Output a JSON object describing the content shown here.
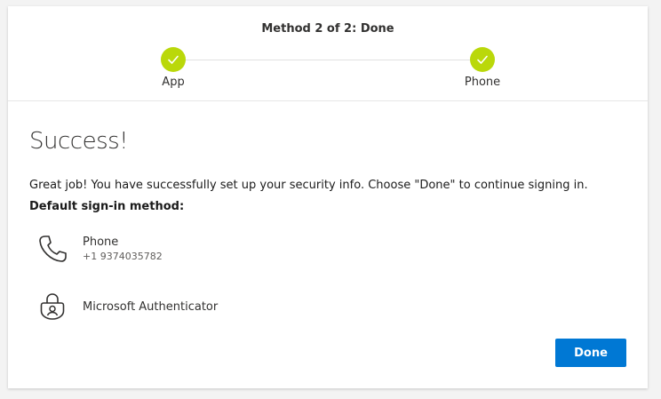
{
  "progress": {
    "title": "Method 2 of 2: Done",
    "steps": [
      {
        "label": "App",
        "status": "completed"
      },
      {
        "label": "Phone",
        "status": "completed"
      }
    ],
    "accent_color": "#bad80a"
  },
  "main": {
    "heading": "Success!",
    "description": "Great job! You have successfully set up your security info. Choose \"Done\" to continue signing in.",
    "default_label": "Default sign-in method:",
    "methods": [
      {
        "name": "Phone",
        "detail": "+1 9374035782",
        "icon": "phone-icon"
      },
      {
        "name": "Microsoft Authenticator",
        "detail": "",
        "icon": "authenticator-icon"
      }
    ]
  },
  "actions": {
    "done_label": "Done",
    "button_color": "#0078d4"
  }
}
